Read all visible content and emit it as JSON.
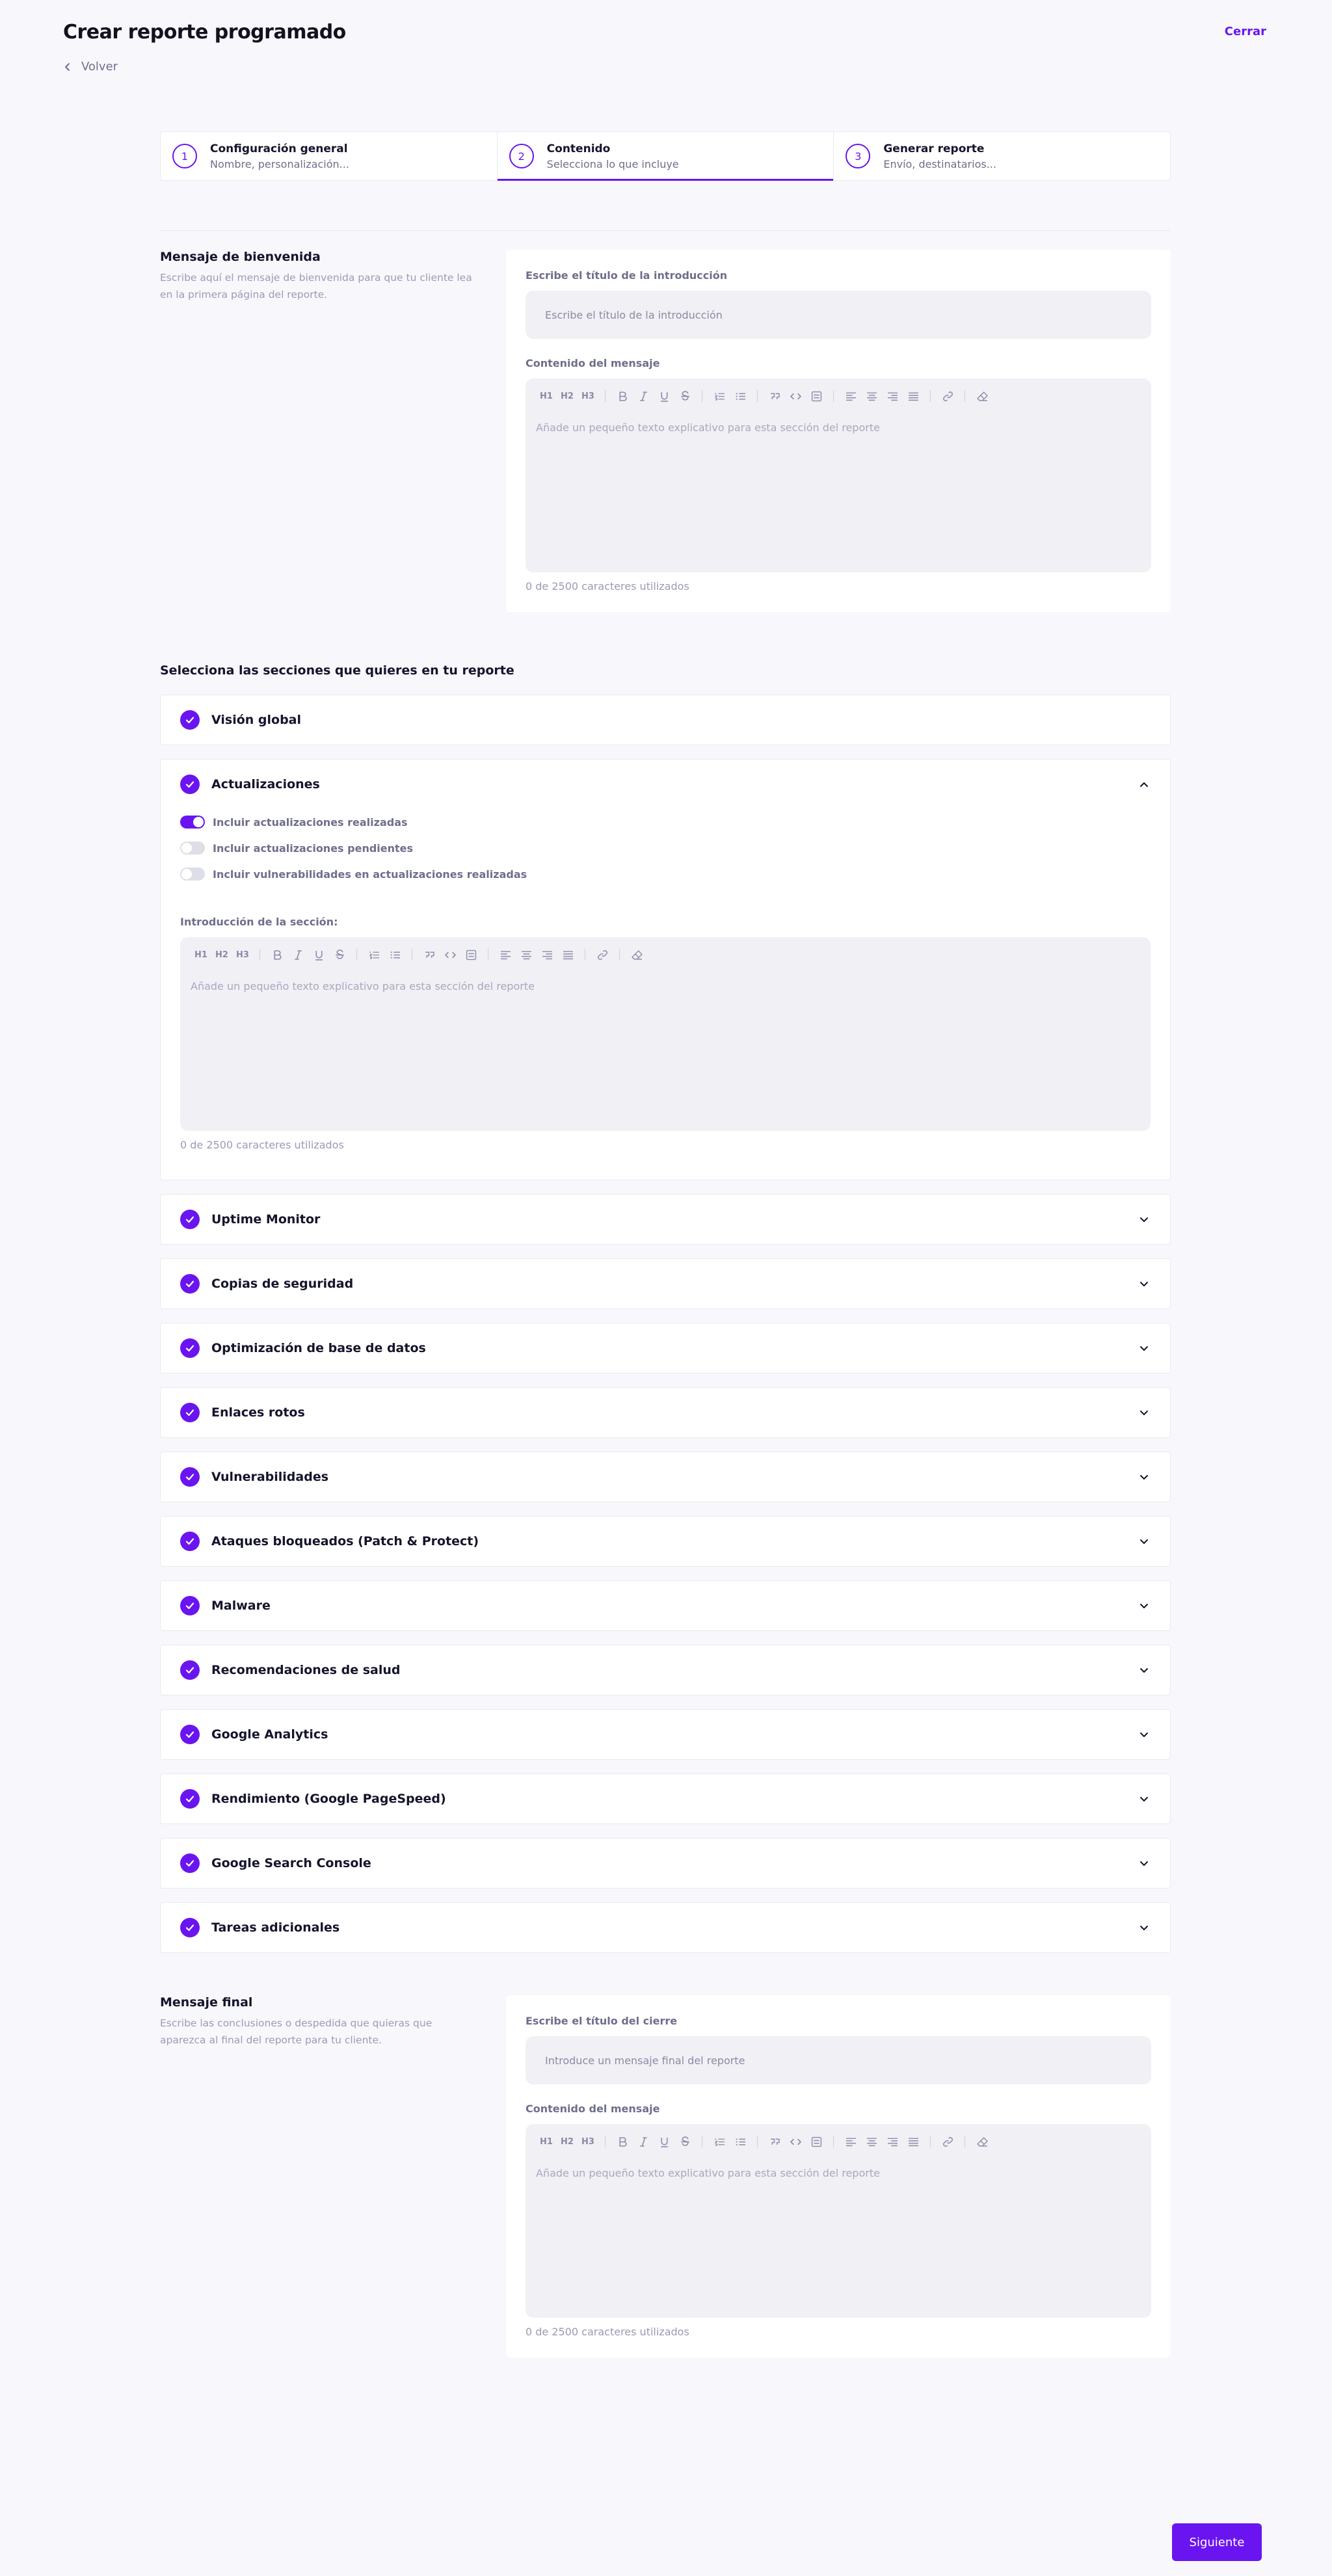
{
  "header": {
    "title": "Crear reporte programado",
    "close_label": "Cerrar",
    "back_label": "Volver"
  },
  "stepper": {
    "steps": [
      {
        "number": "1",
        "title": "Configuración general",
        "subtitle": "Nombre, personalización..."
      },
      {
        "number": "2",
        "title": "Contenido",
        "subtitle": "Selecciona lo que incluye"
      },
      {
        "number": "3",
        "title": "Generar reporte",
        "subtitle": "Envío, destinatarios..."
      }
    ],
    "active_step": 2
  },
  "welcome": {
    "title": "Mensaje de bienvenida",
    "description": "Escribe aquí el mensaje de bienvenida para que tu cliente lea en la primera página del reporte.",
    "title_field_label": "Escribe el título de la introducción",
    "title_field_placeholder": "Escribe el título de la introducción",
    "content_label": "Contenido del mensaje",
    "editor_placeholder": "Añade un pequeño texto explicativo para esta sección del reporte",
    "char_count": "0 de 2500 caracteres utilizados"
  },
  "toolbar": {
    "h1": "H1",
    "h2": "H2",
    "h3": "H3"
  },
  "sections": {
    "heading": "Selecciona las secciones que quieres en tu reporte",
    "items": [
      {
        "label": "Visión global"
      },
      {
        "label": "Actualizaciones"
      },
      {
        "label": "Uptime Monitor"
      },
      {
        "label": "Copias de seguridad"
      },
      {
        "label": "Optimización de base de datos"
      },
      {
        "label": "Enlaces rotos"
      },
      {
        "label": "Vulnerabilidades"
      },
      {
        "label": "Ataques bloqueados (Patch & Protect)"
      },
      {
        "label": "Malware"
      },
      {
        "label": "Recomendaciones de salud"
      },
      {
        "label": "Google Analytics"
      },
      {
        "label": "Rendimiento (Google PageSpeed)"
      },
      {
        "label": "Google Search Console"
      },
      {
        "label": "Tareas adicionales"
      }
    ],
    "updates": {
      "toggles": [
        {
          "label": "Incluir actualizaciones realizadas",
          "on": true
        },
        {
          "label": "Incluir actualizaciones pendientes",
          "on": false
        },
        {
          "label": "Incluir vulnerabilidades en actualizaciones realizadas",
          "on": false
        }
      ],
      "intro_label": "Introducción de la sección:",
      "editor_placeholder": "Añade un pequeño texto explicativo para esta sección del reporte",
      "char_count": "0 de 2500 caracteres utilizados"
    }
  },
  "final": {
    "title": "Mensaje final",
    "description": "Escribe las conclusiones o despedida que quieras que aparezca al final del reporte para tu cliente.",
    "title_field_label": "Escribe el título del cierre",
    "title_field_placeholder": "Introduce un mensaje final del reporte",
    "content_label": "Contenido del mensaje",
    "editor_placeholder": "Añade un pequeño texto explicativo para esta sección del reporte",
    "char_count": "0 de 2500 caracteres utilizados"
  },
  "footer": {
    "next_label": "Siguiente"
  },
  "colors": {
    "accent": "#6a15f0",
    "background": "#f8f8fc"
  }
}
